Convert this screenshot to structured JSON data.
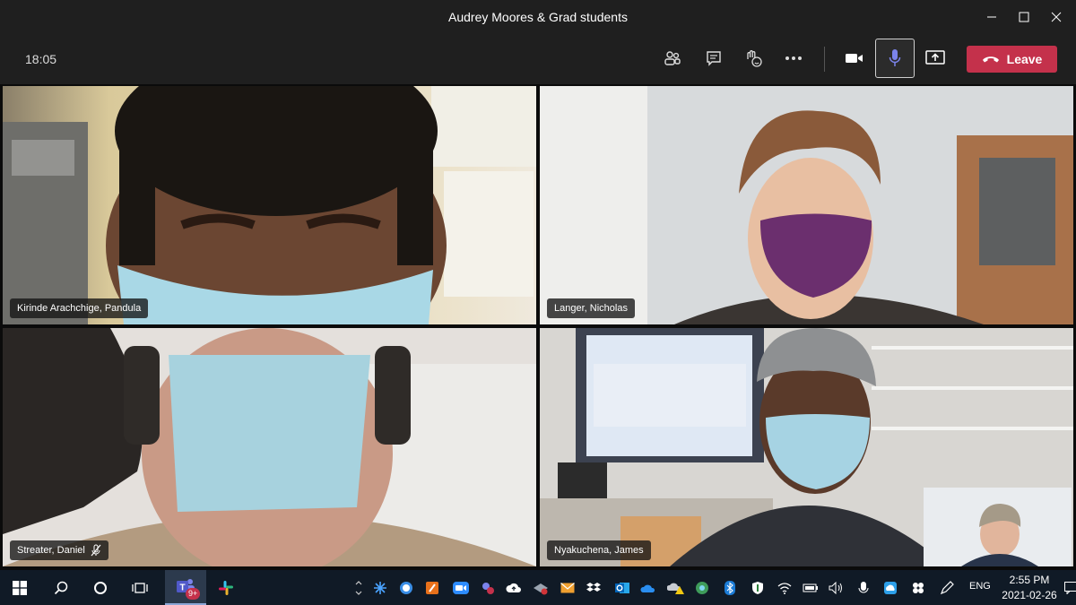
{
  "window": {
    "title": "Audrey Moores & Grad students",
    "icons": [
      "minimize-icon",
      "maximize-icon",
      "close-icon"
    ]
  },
  "callbar": {
    "elapsed_time": "18:05",
    "leave_label": "Leave",
    "icons": [
      "participants-icon",
      "chat-icon",
      "reactions-icon",
      "more-icon",
      "camera-icon",
      "microphone-icon",
      "share-screen-icon",
      "phone-hangup-icon"
    ],
    "colors": {
      "leave": "#c4314b",
      "bar": "#1f1f1f"
    }
  },
  "participants": [
    {
      "name": "Kirinde Arachchige, Pandula",
      "muted": false
    },
    {
      "name": "Langer, Nicholas",
      "muted": false
    },
    {
      "name": "Streater, Daniel",
      "muted": true
    },
    {
      "name": "Nyakuchena, James",
      "muted": false
    }
  ],
  "taskbar": {
    "clock_time": "2:55 PM",
    "clock_date": "2021-02-26",
    "language": "ENG",
    "teams_badge": "9+",
    "pinned_icons": [
      "windows-start-icon",
      "search-icon",
      "cortana-icon",
      "task-view-icon",
      "teams-icon",
      "slack-icon"
    ],
    "tray_icons": [
      "show-hidden-icon",
      "app-tray-icon-1",
      "app-tray-icon-2",
      "app-tray-icon-3",
      "zoom-icon",
      "app-tray-icon-4",
      "cloud-upload-icon",
      "app-tray-icon-5",
      "mail-icon",
      "dropbox-icon",
      "outlook-icon",
      "onedrive-icon",
      "onedrive-warning-icon",
      "app-tray-icon-6",
      "bluetooth-icon",
      "security-icon",
      "network-icon",
      "battery-icon",
      "volume-icon",
      "microphone-tray-icon",
      "app-tray-icon-7",
      "app-tray-icon-8",
      "pen-icon",
      "notification-icon"
    ]
  }
}
